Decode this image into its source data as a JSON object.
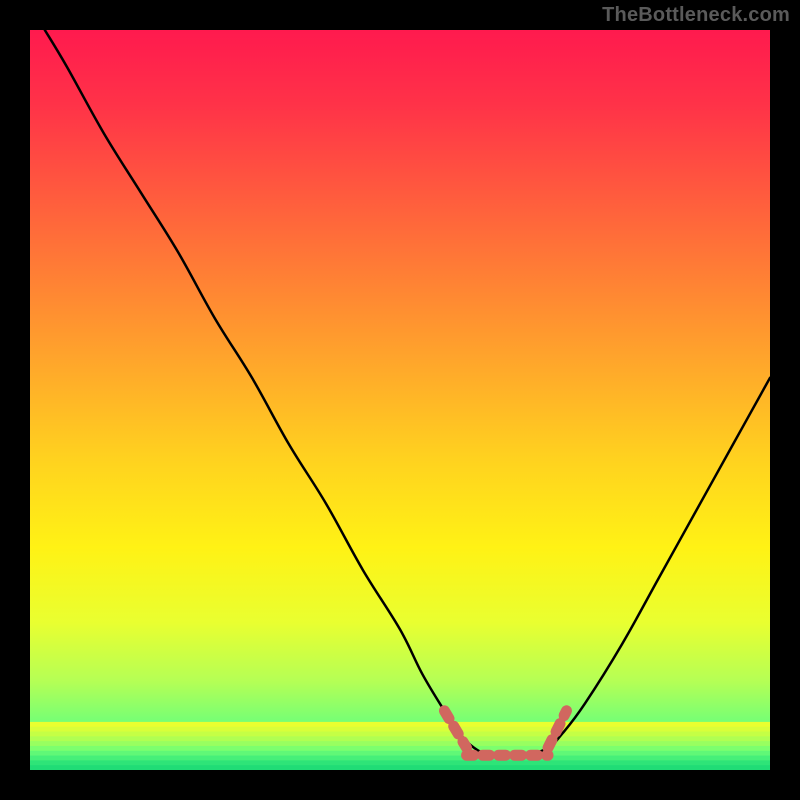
{
  "watermark": "TheBottleneck.com",
  "chart_data": {
    "type": "line",
    "title": "",
    "xlabel": "",
    "ylabel": "",
    "xlim": [
      0,
      100
    ],
    "ylim": [
      0,
      100
    ],
    "grid": false,
    "series": [
      {
        "name": "bottleneck-curve",
        "x": [
          2,
          5,
          10,
          15,
          20,
          25,
          30,
          35,
          40,
          45,
          50,
          53,
          56,
          58,
          60,
          62,
          64,
          67,
          70,
          72,
          75,
          80,
          85,
          90,
          95,
          100
        ],
        "y": [
          100,
          95,
          86,
          78,
          70,
          61,
          53,
          44,
          36,
          27,
          19,
          13,
          8,
          5,
          3,
          2,
          2,
          2,
          3,
          5,
          9,
          17,
          26,
          35,
          44,
          53
        ],
        "color": "#000000"
      },
      {
        "name": "optimal-range-left-marker",
        "x": [
          56,
          59
        ],
        "y": [
          8,
          3
        ],
        "color": "#d1675f"
      },
      {
        "name": "optimal-range-flat-marker",
        "x": [
          59,
          70
        ],
        "y": [
          2,
          2
        ],
        "color": "#d1675f"
      },
      {
        "name": "optimal-range-right-marker",
        "x": [
          70,
          72.5
        ],
        "y": [
          3,
          8
        ],
        "color": "#d1675f"
      }
    ],
    "background_gradient": {
      "stops": [
        {
          "offset": 0.0,
          "color": "#ff1a4e"
        },
        {
          "offset": 0.1,
          "color": "#ff3248"
        },
        {
          "offset": 0.22,
          "color": "#ff5a3e"
        },
        {
          "offset": 0.34,
          "color": "#ff8234"
        },
        {
          "offset": 0.46,
          "color": "#ffaa2a"
        },
        {
          "offset": 0.58,
          "color": "#ffd21f"
        },
        {
          "offset": 0.7,
          "color": "#fff215"
        },
        {
          "offset": 0.8,
          "color": "#e9ff30"
        },
        {
          "offset": 0.88,
          "color": "#b5ff55"
        },
        {
          "offset": 0.94,
          "color": "#70ff78"
        },
        {
          "offset": 1.0,
          "color": "#20e878"
        }
      ]
    },
    "bottom_stripes": [
      "#e9ff30",
      "#d8ff3a",
      "#c5ff45",
      "#b0ff52",
      "#98ff60",
      "#7cff6e",
      "#60f877",
      "#46ef79",
      "#2ee478",
      "#20dc76"
    ]
  }
}
